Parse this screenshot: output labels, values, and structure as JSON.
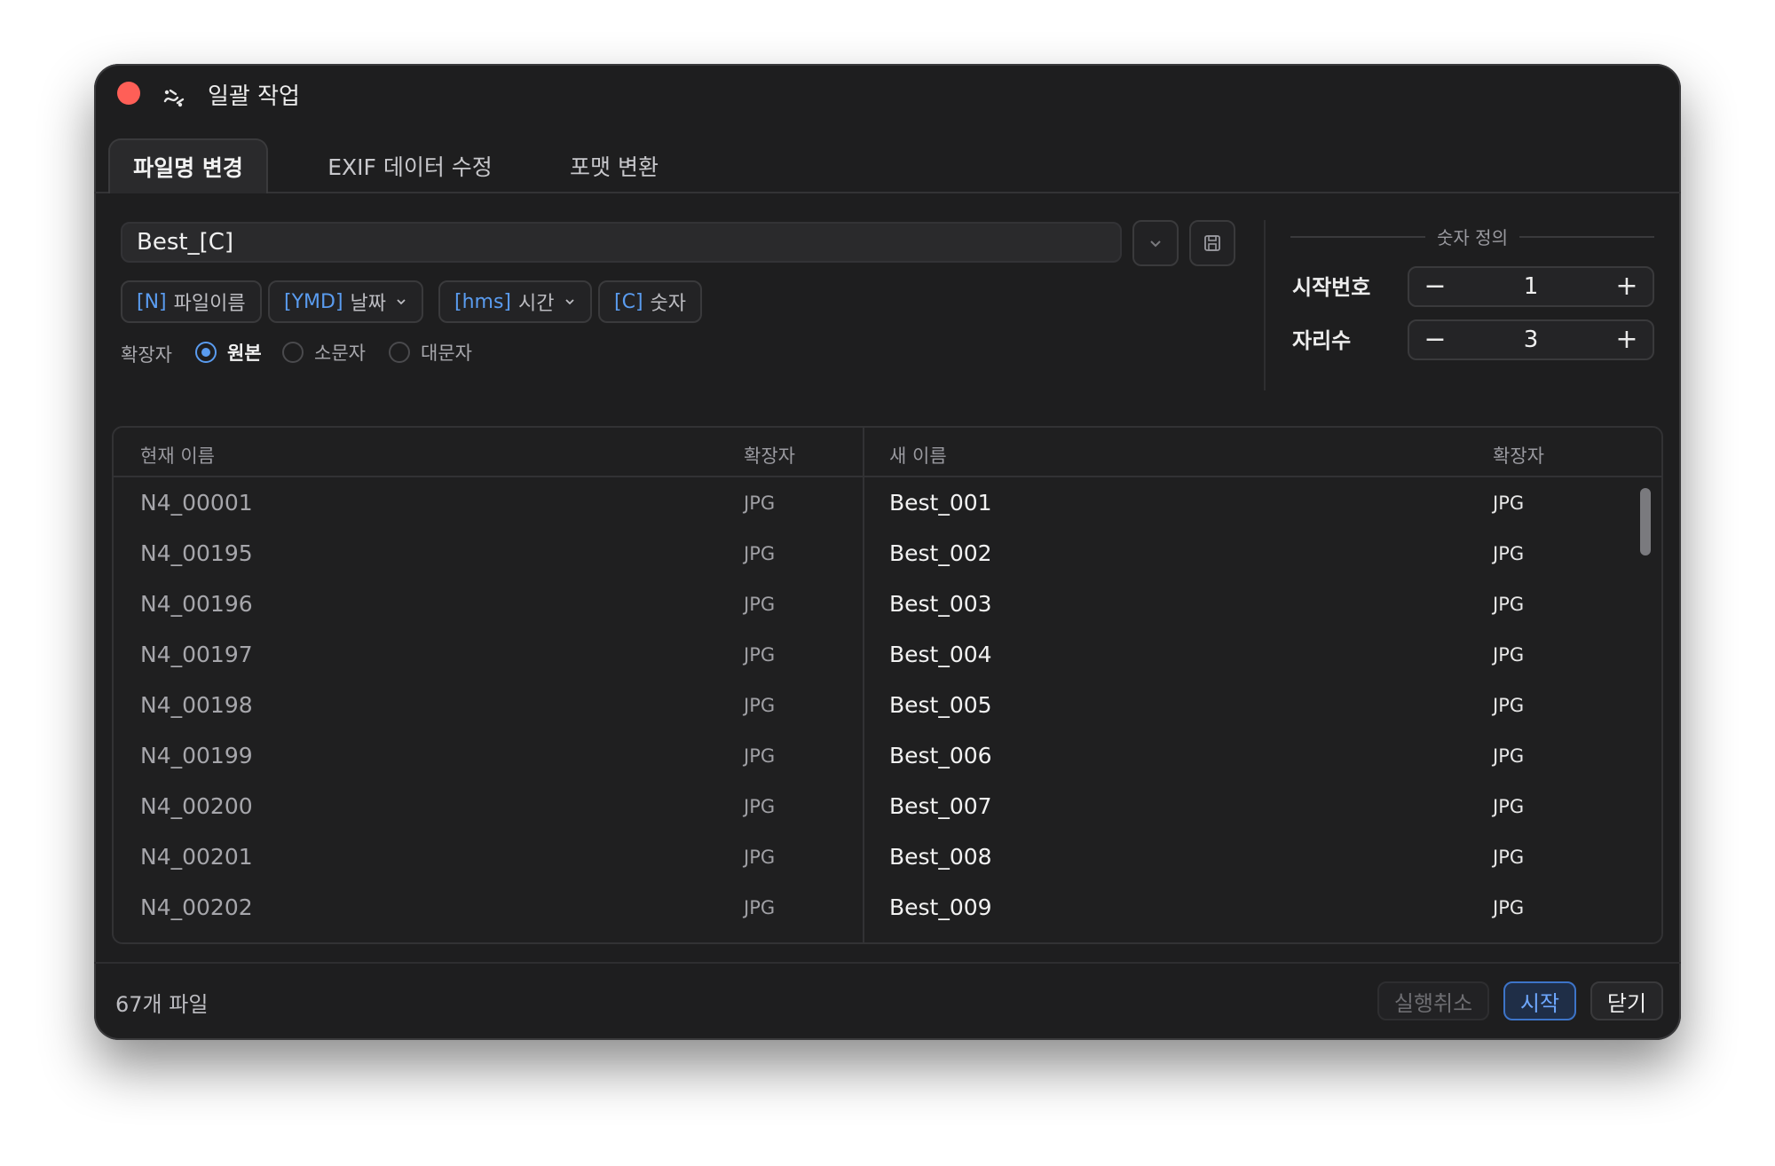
{
  "window": {
    "title": "일괄 작업",
    "colors": {
      "close": "#ff5f57",
      "accent": "#5a9cf0",
      "background": "#1e1e1f"
    }
  },
  "tabs": [
    {
      "label": "파일명 변경",
      "active": true
    },
    {
      "label": "EXIF 데이터 수정",
      "active": false
    },
    {
      "label": "포맷 변환",
      "active": false
    }
  ],
  "pattern": {
    "value": "Best_[C]"
  },
  "tokens": [
    {
      "code": "[N]",
      "label": "파일이름",
      "dropdown": false
    },
    {
      "code": "[YMD]",
      "label": "날짜",
      "dropdown": true
    },
    {
      "code": "[hms]",
      "label": "시간",
      "dropdown": true
    },
    {
      "code": "[C]",
      "label": "숫자",
      "dropdown": false
    }
  ],
  "extension": {
    "label": "확장자",
    "options": [
      {
        "label": "원본",
        "selected": true
      },
      {
        "label": "소문자",
        "selected": false
      },
      {
        "label": "대문자",
        "selected": false
      }
    ]
  },
  "number_definition": {
    "header": "숫자 정의",
    "start": {
      "label": "시작번호",
      "value": "1"
    },
    "digits": {
      "label": "자리수",
      "value": "3"
    }
  },
  "table": {
    "headers": {
      "current": "현재 이름",
      "ext1": "확장자",
      "new": "새 이름",
      "ext2": "확장자"
    },
    "rows": [
      {
        "current": "N4_00001",
        "ext": "JPG",
        "new": "Best_001",
        "new_ext": "JPG"
      },
      {
        "current": "N4_00195",
        "ext": "JPG",
        "new": "Best_002",
        "new_ext": "JPG"
      },
      {
        "current": "N4_00196",
        "ext": "JPG",
        "new": "Best_003",
        "new_ext": "JPG"
      },
      {
        "current": "N4_00197",
        "ext": "JPG",
        "new": "Best_004",
        "new_ext": "JPG"
      },
      {
        "current": "N4_00198",
        "ext": "JPG",
        "new": "Best_005",
        "new_ext": "JPG"
      },
      {
        "current": "N4_00199",
        "ext": "JPG",
        "new": "Best_006",
        "new_ext": "JPG"
      },
      {
        "current": "N4_00200",
        "ext": "JPG",
        "new": "Best_007",
        "new_ext": "JPG"
      },
      {
        "current": "N4_00201",
        "ext": "JPG",
        "new": "Best_008",
        "new_ext": "JPG"
      },
      {
        "current": "N4_00202",
        "ext": "JPG",
        "new": "Best_009",
        "new_ext": "JPG"
      }
    ]
  },
  "footer": {
    "file_count": "67개 파일",
    "undo_label": "실행취소",
    "start_label": "시작",
    "close_label": "닫기"
  }
}
